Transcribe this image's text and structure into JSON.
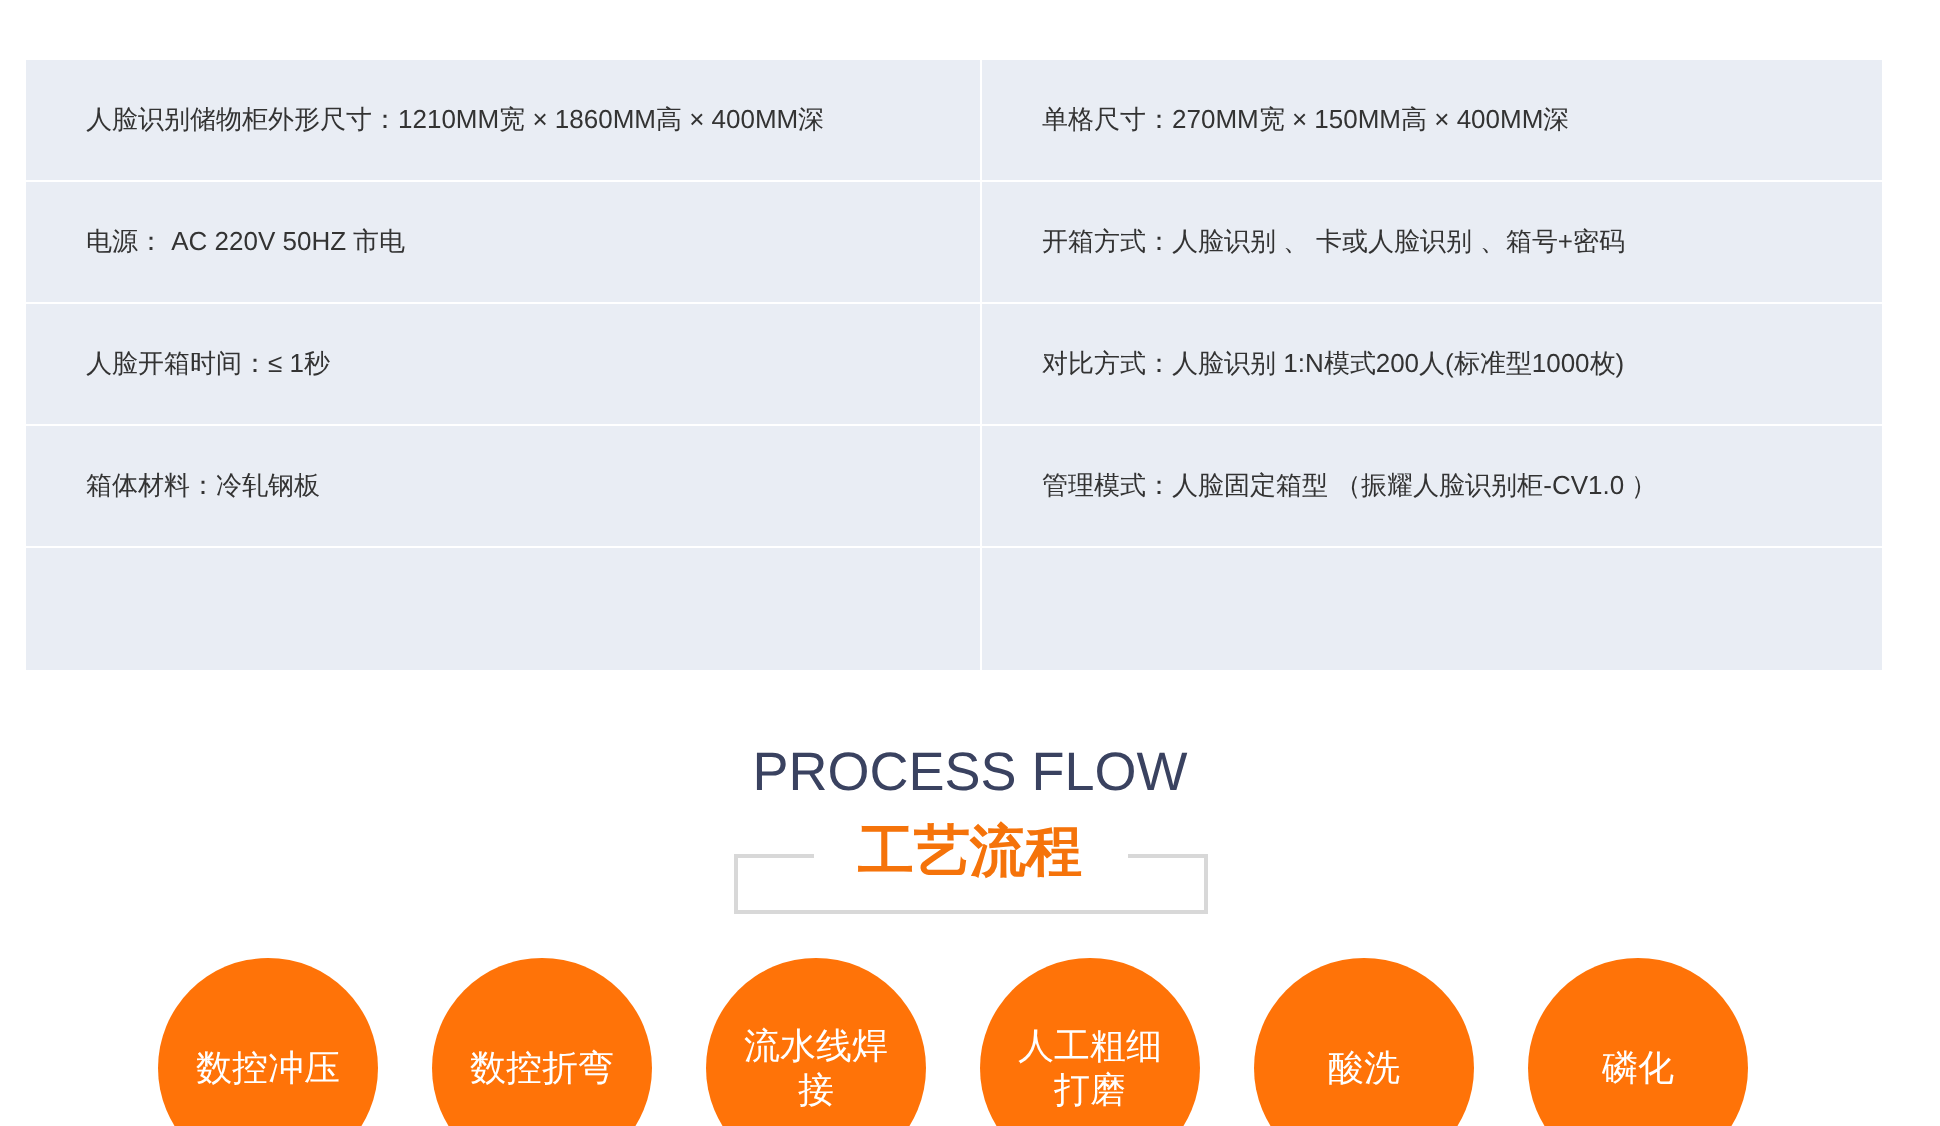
{
  "spec_table": {
    "rows": [
      {
        "cells": [
          "人脸识别储物柜外形尺寸：1210MM宽 × 1860MM高 × 400MM深",
          "单格尺寸：270MM宽 × 150MM高 × 400MM深"
        ]
      },
      {
        "cells": [
          "电源： AC 220V 50HZ 市电",
          "开箱方式：人脸识别 、 卡或人脸识别 、箱号+密码"
        ]
      },
      {
        "cells": [
          "人脸开箱时间：≤ 1秒",
          "对比方式：人脸识别 1:N模式200人(标准型1000枚)"
        ]
      },
      {
        "cells": [
          "箱体材料：冷轧钢板",
          "管理模式：人脸固定箱型 （振耀人脸识别柜-CV1.0 ）"
        ]
      },
      {
        "cells": []
      }
    ]
  },
  "process_flow": {
    "title_en": "PROCESS FLOW",
    "title_cn": "工艺流程",
    "steps": [
      "数控冲压",
      "数控折弯",
      "流水线焊接",
      "人工粗细打磨",
      "酸洗",
      "磷化"
    ]
  }
}
